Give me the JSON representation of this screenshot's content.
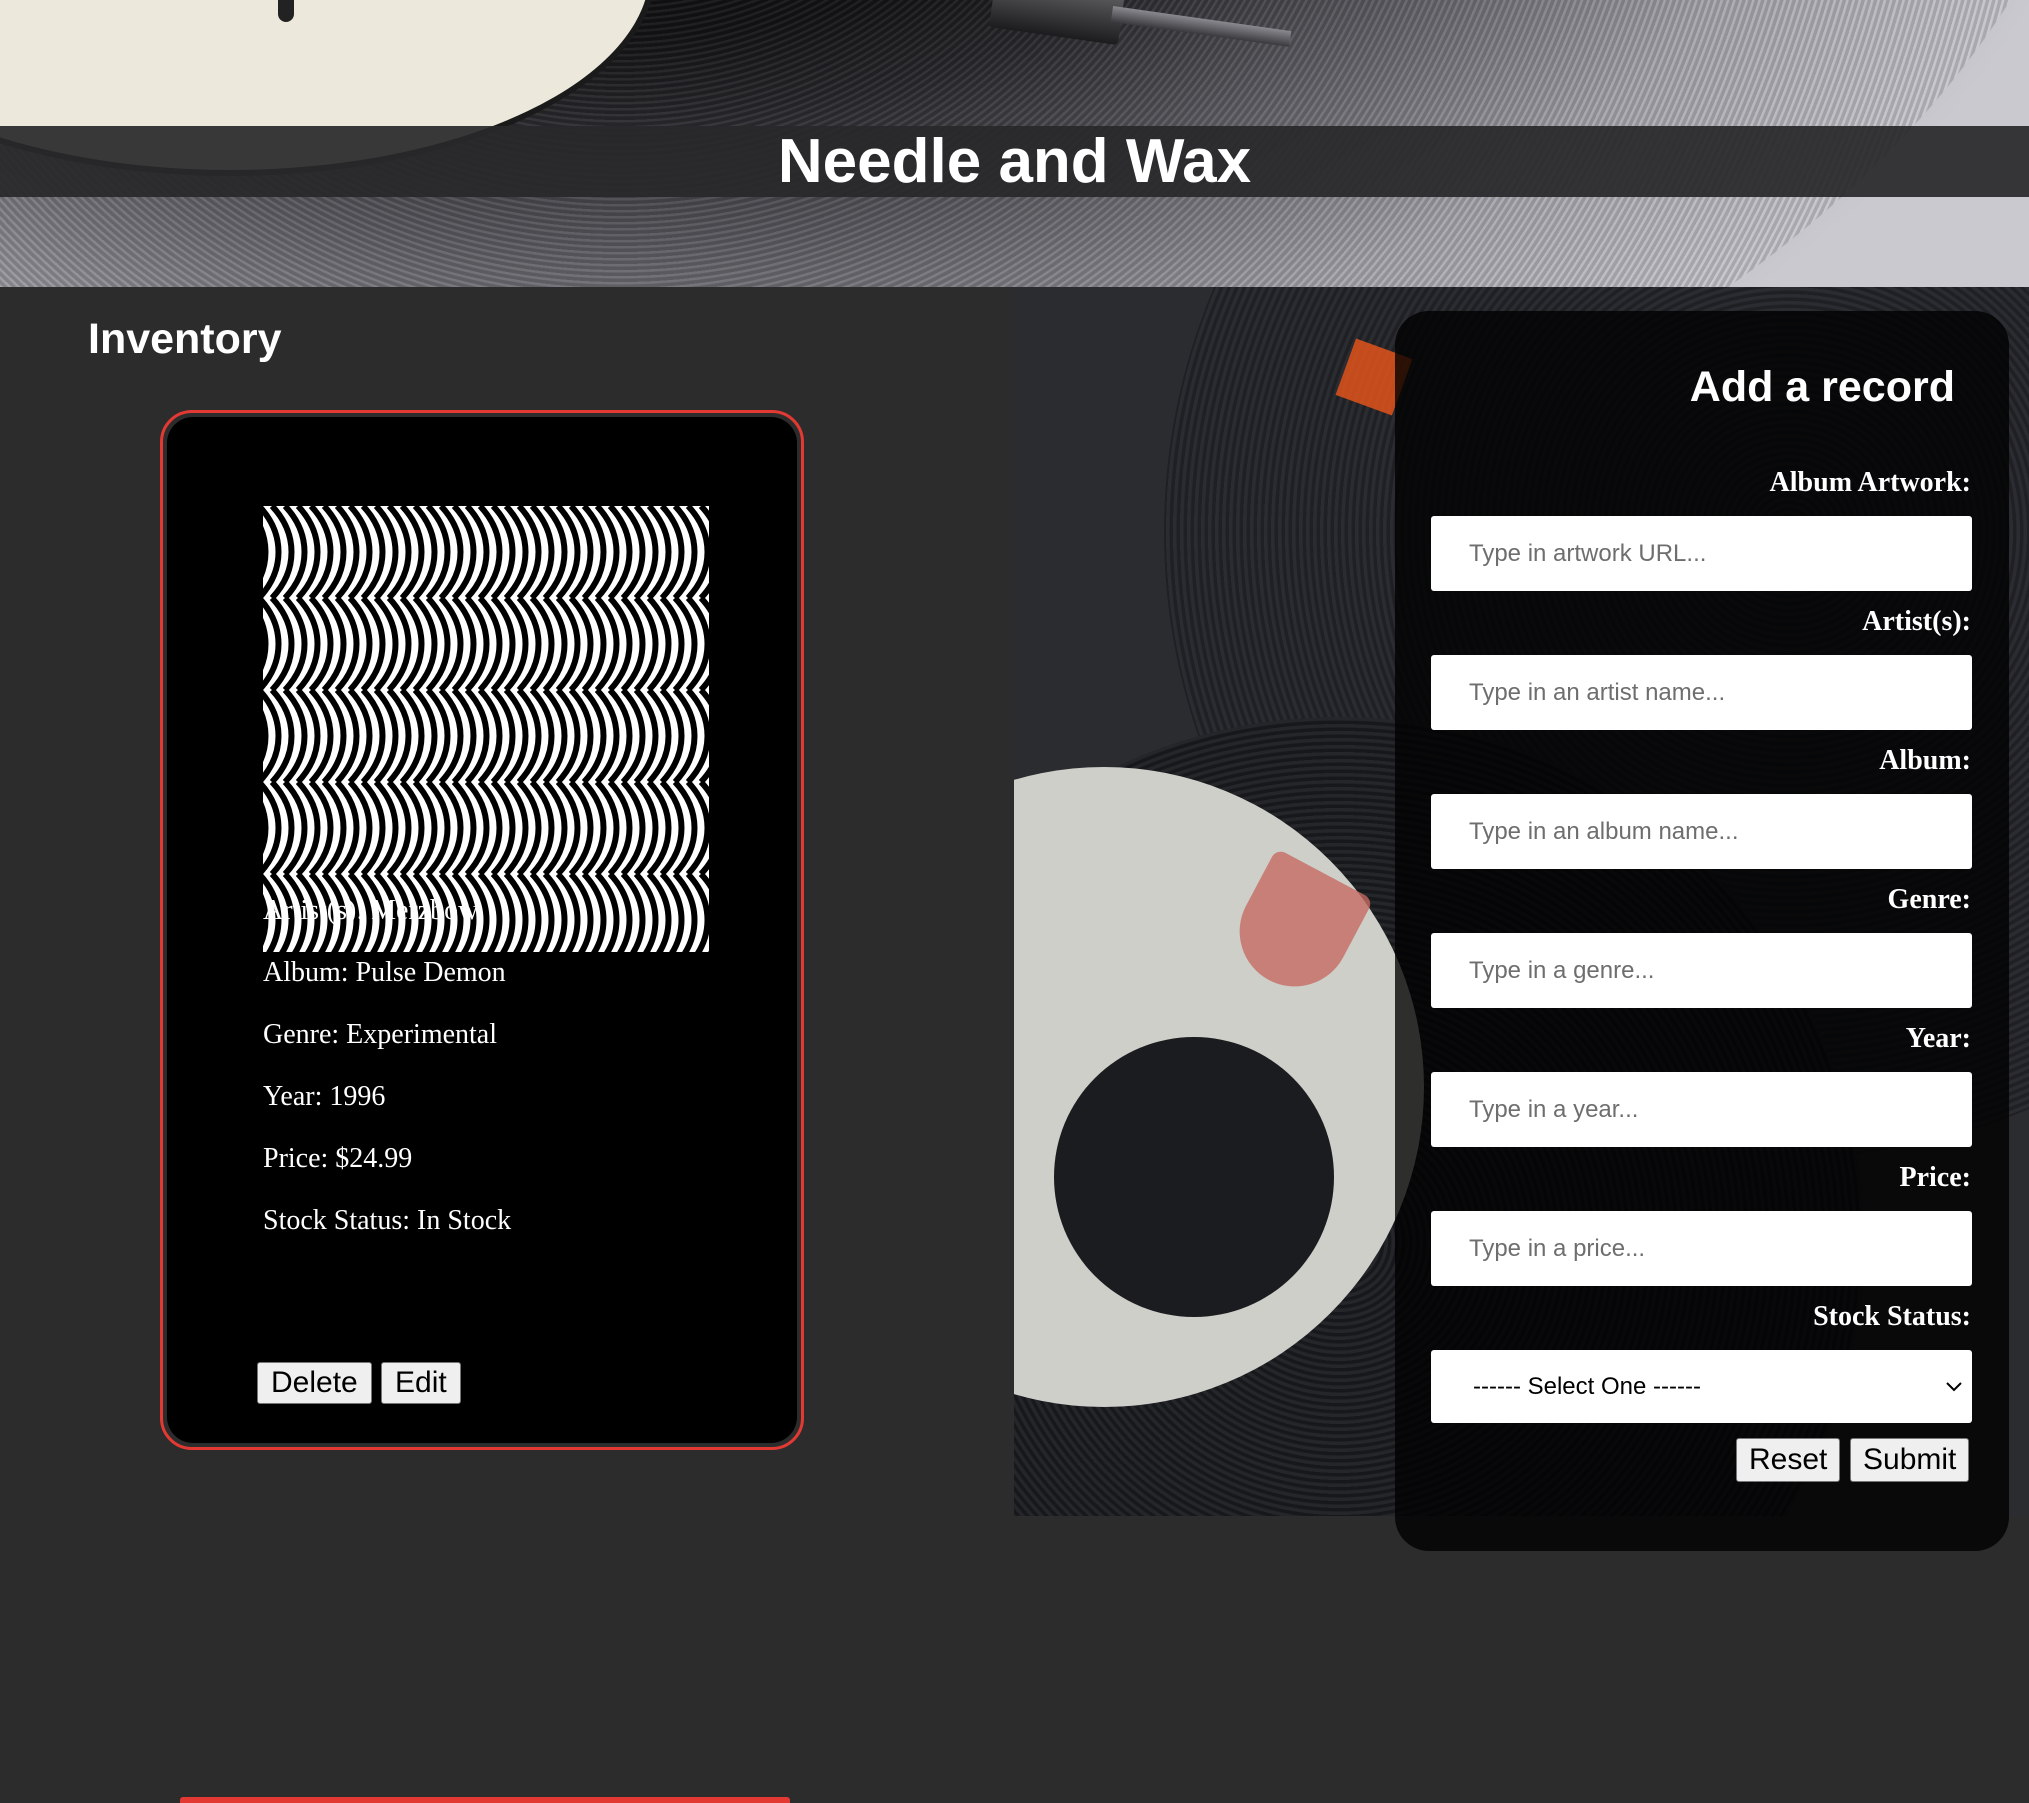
{
  "header": {
    "title": "Needle and Wax"
  },
  "inventory": {
    "heading": "Inventory",
    "records": [
      {
        "artwork_icon": "op-art-wave-pattern",
        "artist": "Artist(s): Merzbow",
        "album": "Album: Pulse Demon",
        "genre": "Genre: Experimental",
        "year": "Year: 1996",
        "price": "Price: $24.99",
        "stock": "Stock Status: In Stock",
        "delete_label": "Delete",
        "edit_label": "Edit"
      }
    ]
  },
  "form": {
    "heading": "Add a record",
    "fields": [
      {
        "label": "Album Artwork:",
        "placeholder": "Type in artwork URL...",
        "value": ""
      },
      {
        "label": "Artist(s):",
        "placeholder": "Type in an artist name...",
        "value": ""
      },
      {
        "label": "Album:",
        "placeholder": "Type in an album name...",
        "value": ""
      },
      {
        "label": "Genre:",
        "placeholder": "Type in a genre...",
        "value": ""
      },
      {
        "label": "Year:",
        "placeholder": "Type in a year...",
        "value": ""
      },
      {
        "label": "Price:",
        "placeholder": "Type in a price...",
        "value": ""
      }
    ],
    "stock_status": {
      "label": "Stock Status:",
      "selected": "------ Select One ------"
    },
    "reset_label": "Reset",
    "submit_label": "Submit"
  },
  "colors": {
    "card_border": "#e23a33",
    "page_background": "#2c2c2d",
    "card_background": "#000000",
    "text": "#ffffff"
  }
}
